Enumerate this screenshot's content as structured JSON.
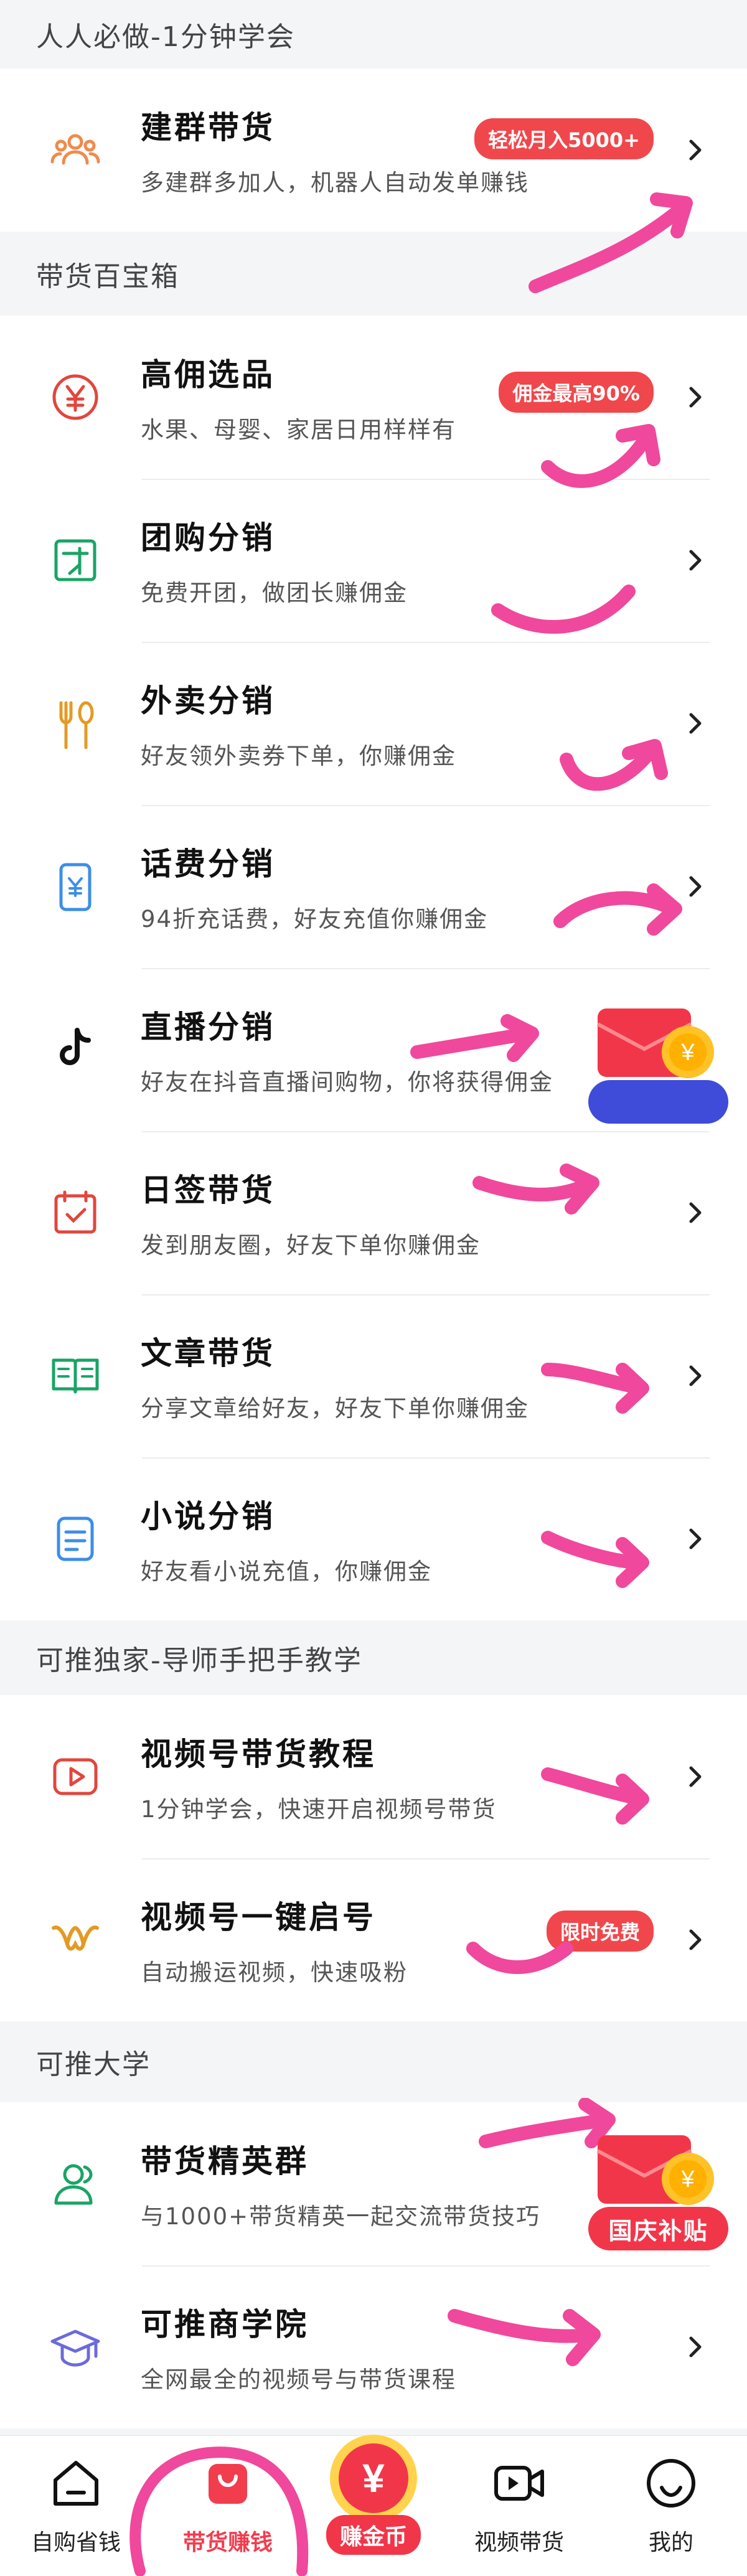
{
  "sections": [
    {
      "header": "人人必做-1分钟学会",
      "items": [
        {
          "title": "建群带货",
          "sub": "多建群多加人，机器人自动发单赚钱",
          "badge": "轻松月入5000+",
          "icon": "people-icon"
        }
      ]
    },
    {
      "header": "带货百宝箱",
      "items": [
        {
          "title": "高佣选品",
          "sub": "水果、母婴、家居日用样样有",
          "badge": "佣金最高90%",
          "icon": "yen-circle-icon"
        },
        {
          "title": "团购分销",
          "sub": "免费开团，做团长赚佣金",
          "icon": "group-buy-icon"
        },
        {
          "title": "外卖分销",
          "sub": "好友领外卖券下单，你赚佣金",
          "icon": "fork-spoon-icon"
        },
        {
          "title": "话费分销",
          "sub": "94折充话费，好友充值你赚佣金",
          "icon": "phone-yen-icon"
        },
        {
          "title": "直播分销",
          "sub": "好友在抖音直播间购物，你将获得佣金",
          "icon": "tiktok-icon"
        },
        {
          "title": "日签带货",
          "sub": "发到朋友圈，好友下单你赚佣金",
          "icon": "calendar-check-icon"
        },
        {
          "title": "文章带货",
          "sub": "分享文章给好友，好友下单你赚佣金",
          "icon": "book-icon"
        },
        {
          "title": "小说分销",
          "sub": "好友看小说充值，你赚佣金",
          "icon": "document-icon"
        }
      ]
    },
    {
      "header": "可推独家-导师手把手教学",
      "items": [
        {
          "title": "视频号带货教程",
          "sub": "1分钟学会，快速开启视频号带货",
          "icon": "video-play-icon"
        },
        {
          "title": "视频号一键启号",
          "sub": "自动搬运视频，快速吸粉",
          "badge": "限时免费",
          "icon": "channels-icon"
        }
      ]
    },
    {
      "header": "可推大学",
      "items": [
        {
          "title": "带货精英群",
          "sub": "与1000+带货精英一起交流带货技巧",
          "icon": "user-group-icon"
        },
        {
          "title": "可推商学院",
          "sub": "全网最全的视频号与带货课程",
          "icon": "graduation-cap-icon"
        }
      ]
    }
  ],
  "float_promo": {
    "label": "国庆补贴"
  },
  "tabbar": {
    "tabs": [
      {
        "label": "自购省钱",
        "icon": "home-icon"
      },
      {
        "label": "带货赚钱",
        "icon": "shopping-bag-icon"
      },
      {
        "label": "赚金币",
        "icon": "yen-coin-icon"
      },
      {
        "label": "视频带货",
        "icon": "video-camera-icon"
      },
      {
        "label": "我的",
        "icon": "smile-icon"
      }
    ],
    "active_index": 1
  },
  "colors": {
    "accent": "#f23d4f",
    "badge": "#f0474c",
    "annotation": "#f0489c"
  }
}
